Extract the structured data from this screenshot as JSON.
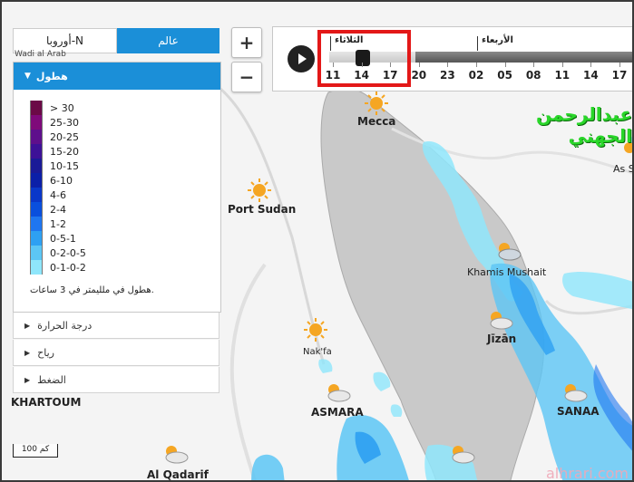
{
  "tabs": {
    "world": "عالم",
    "europe": "أوروبا-N"
  },
  "partial_label": "Wadi al Arab",
  "legend": {
    "title": "هطول",
    "items": [
      {
        "label": "> 30",
        "color": "#6b0a47"
      },
      {
        "label": "25-30",
        "color": "#7f0a7a"
      },
      {
        "label": "20-25",
        "color": "#5e0f8c"
      },
      {
        "label": "15-20",
        "color": "#3d1197"
      },
      {
        "label": "10-15",
        "color": "#1a1a97"
      },
      {
        "label": "6-10",
        "color": "#0b1fa8"
      },
      {
        "label": "4-6",
        "color": "#0a37c9"
      },
      {
        "label": "2-4",
        "color": "#0a4fdd"
      },
      {
        "label": "1-2",
        "color": "#1f76f0"
      },
      {
        "label": "0-5-1",
        "color": "#2ea0f2"
      },
      {
        "label": "0-2-0-5",
        "color": "#5cc6f5"
      },
      {
        "label": "0-1-0-2",
        "color": "#8fe6fb"
      }
    ],
    "note": "هطول في ملليمتر في 3 ساعات."
  },
  "accordion": {
    "temperature": "درجة الحرارة",
    "wind": "رياح",
    "pressure": "الضغط"
  },
  "zoom": {
    "in": "+",
    "out": "−"
  },
  "timeline": {
    "days": [
      {
        "label": "الثلاثاء"
      },
      {
        "label": "الأربعاء"
      }
    ],
    "hours": [
      "11",
      "14",
      "17",
      "20",
      "23",
      "02",
      "05",
      "08",
      "11",
      "14",
      "17"
    ]
  },
  "map_labels": [
    {
      "id": "mecca",
      "text": "Mecca"
    },
    {
      "id": "port-sudan",
      "text": "Port Sudan"
    },
    {
      "id": "khamis",
      "text": "Khamis Mushait"
    },
    {
      "id": "jizan",
      "text": "Jīzān"
    },
    {
      "id": "nakfa",
      "text": "Nak'fa"
    },
    {
      "id": "asmara",
      "text": "ASMARA"
    },
    {
      "id": "sanaa",
      "text": "SANAA"
    },
    {
      "id": "khartoum",
      "text": "KHARTOUM"
    },
    {
      "id": "gedaref",
      "text": "Al Qadarif"
    },
    {
      "id": "as",
      "text": "As S"
    }
  ],
  "author": "عبدالرحمن الجهني",
  "scale": "100 كم",
  "watermark": "alhrari.com"
}
